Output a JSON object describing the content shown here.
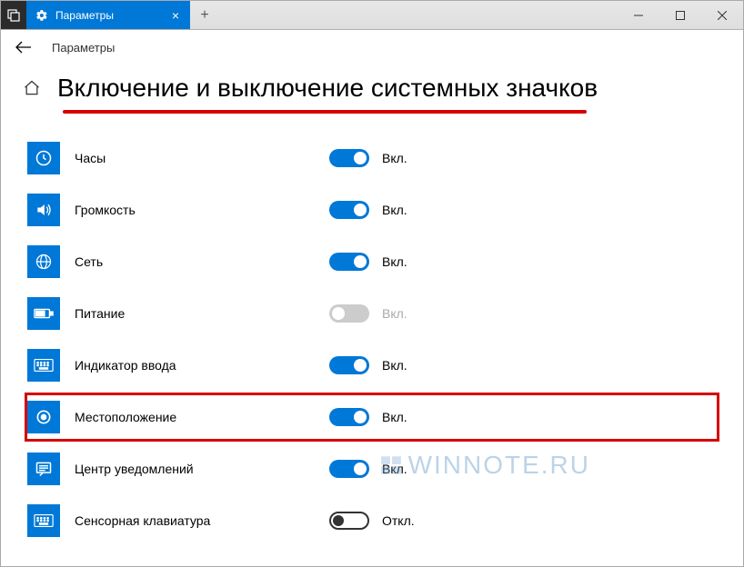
{
  "tab": {
    "title": "Параметры"
  },
  "breadcrumb": {
    "label": "Параметры"
  },
  "page": {
    "title": "Включение и выключение системных значков"
  },
  "toggle_labels": {
    "on": "Вкл.",
    "off": "Откл."
  },
  "rows": [
    {
      "icon": "clock",
      "label": "Часы",
      "state": "on"
    },
    {
      "icon": "volume",
      "label": "Громкость",
      "state": "on"
    },
    {
      "icon": "network",
      "label": "Сеть",
      "state": "on"
    },
    {
      "icon": "power",
      "label": "Питание",
      "state": "disabled"
    },
    {
      "icon": "keyboard",
      "label": "Индикатор ввода",
      "state": "on"
    },
    {
      "icon": "location",
      "label": "Местоположение",
      "state": "on",
      "highlighted": true
    },
    {
      "icon": "notifications",
      "label": "Центр уведомлений",
      "state": "on"
    },
    {
      "icon": "keyboard",
      "label": "Сенсорная клавиатура",
      "state": "off"
    }
  ],
  "watermark": "WINNOTE.RU"
}
